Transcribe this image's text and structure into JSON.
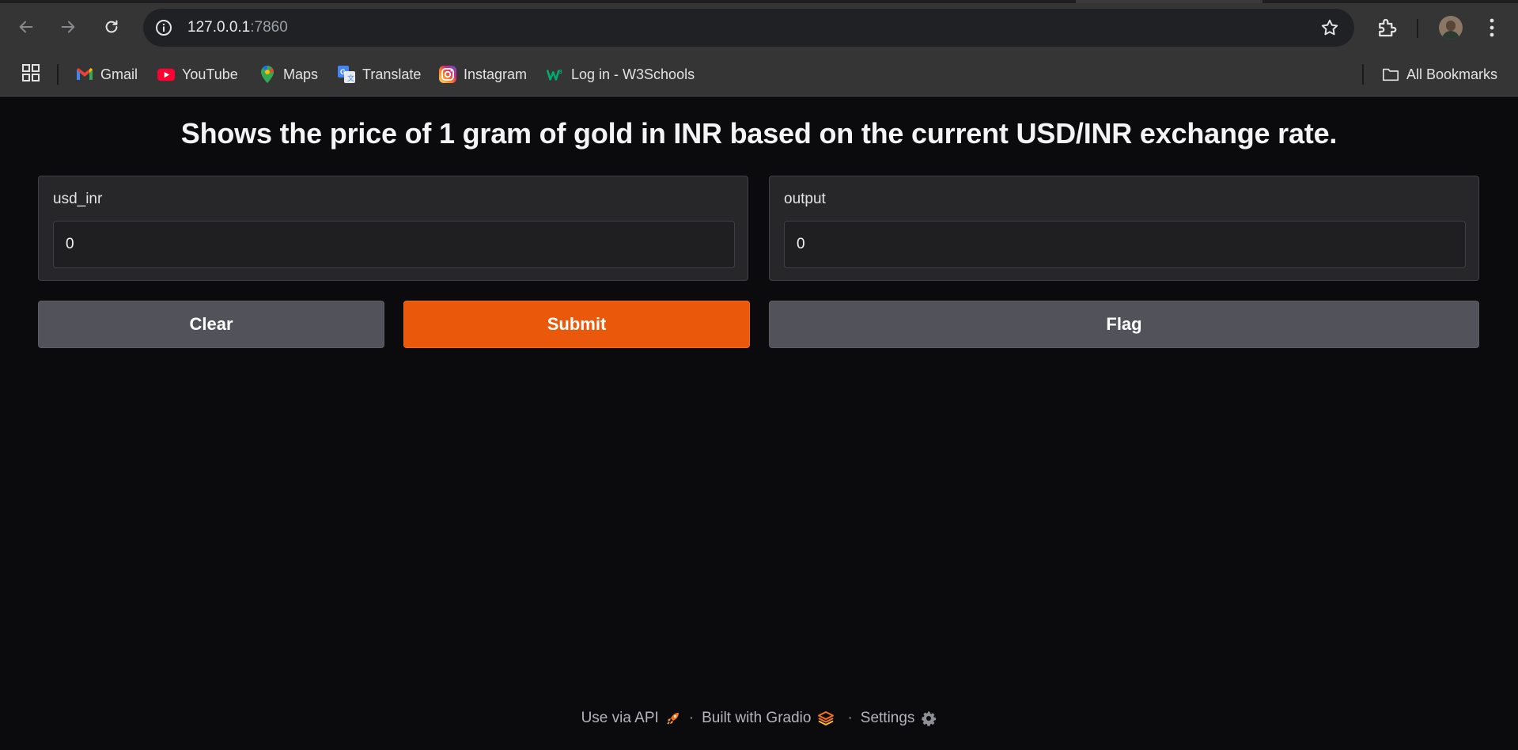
{
  "browser": {
    "url_host": "127.0.0.1",
    "url_port": ":7860",
    "bookmarks": [
      {
        "label": "Gmail",
        "icon": "gmail-icon"
      },
      {
        "label": "YouTube",
        "icon": "youtube-icon"
      },
      {
        "label": "Maps",
        "icon": "maps-icon"
      },
      {
        "label": "Translate",
        "icon": "translate-icon"
      },
      {
        "label": "Instagram",
        "icon": "instagram-icon"
      },
      {
        "label": "Log in - W3Schools",
        "icon": "w3schools-icon"
      }
    ],
    "all_bookmarks_label": "All Bookmarks"
  },
  "app": {
    "title": "Shows the price of 1 gram of gold in INR based on the current USD/INR exchange rate.",
    "input": {
      "label": "usd_inr",
      "value": "0"
    },
    "output": {
      "label": "output",
      "value": "0"
    },
    "buttons": {
      "clear": "Clear",
      "submit": "Submit",
      "flag": "Flag"
    },
    "accent_color": "#ea580c"
  },
  "footer": {
    "api_label": "Use via API",
    "separator": "·",
    "built_label": "Built with Gradio",
    "settings_label": "Settings"
  }
}
